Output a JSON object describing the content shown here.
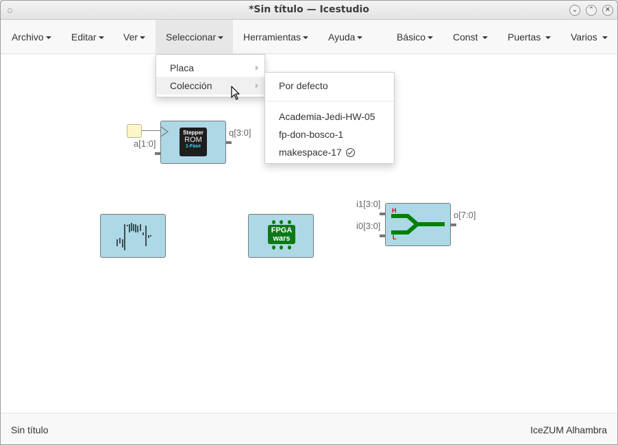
{
  "window": {
    "title": "*Sin título — Icestudio",
    "controls": [
      "⌄",
      "⌃",
      "✕"
    ]
  },
  "menubar": {
    "left": [
      "Archivo",
      "Editar",
      "Ver",
      "Seleccionar",
      "Herramientas",
      "Ayuda"
    ],
    "right": [
      "Básico",
      "Const",
      "Puertas",
      "Varios"
    ],
    "active": "Seleccionar"
  },
  "select_menu": {
    "items": [
      {
        "label": "Placa",
        "has_submenu": true
      },
      {
        "label": "Colección",
        "has_submenu": true,
        "highlighted": true
      }
    ]
  },
  "collection_submenu": {
    "default_item": "Por defecto",
    "items": [
      "Academia-Jedi-HW-05",
      "fp-don-bosco-1",
      "makespace-17"
    ],
    "checked_item": "makespace-17"
  },
  "blocks": {
    "rom": {
      "chip_line1": "Stepper",
      "chip_line2": "ROM",
      "chip_line3": "1-Fase",
      "input_label": "a[1:0]",
      "output_label": "q[3:0]"
    },
    "mux": {
      "input1_label": "i1[3:0]",
      "input0_label": "i0[3:0]",
      "output_label": "o[7:0]",
      "high_mark": "H",
      "low_mark": "L"
    },
    "fpga_wars": {
      "line1": "FPGA",
      "line2": "wars"
    }
  },
  "statusbar": {
    "left": "Sin título",
    "right": "IceZUM Alhambra"
  },
  "colors": {
    "block_fill": "#add8e6",
    "green": "#008000",
    "input_box": "#fdf6c7"
  }
}
